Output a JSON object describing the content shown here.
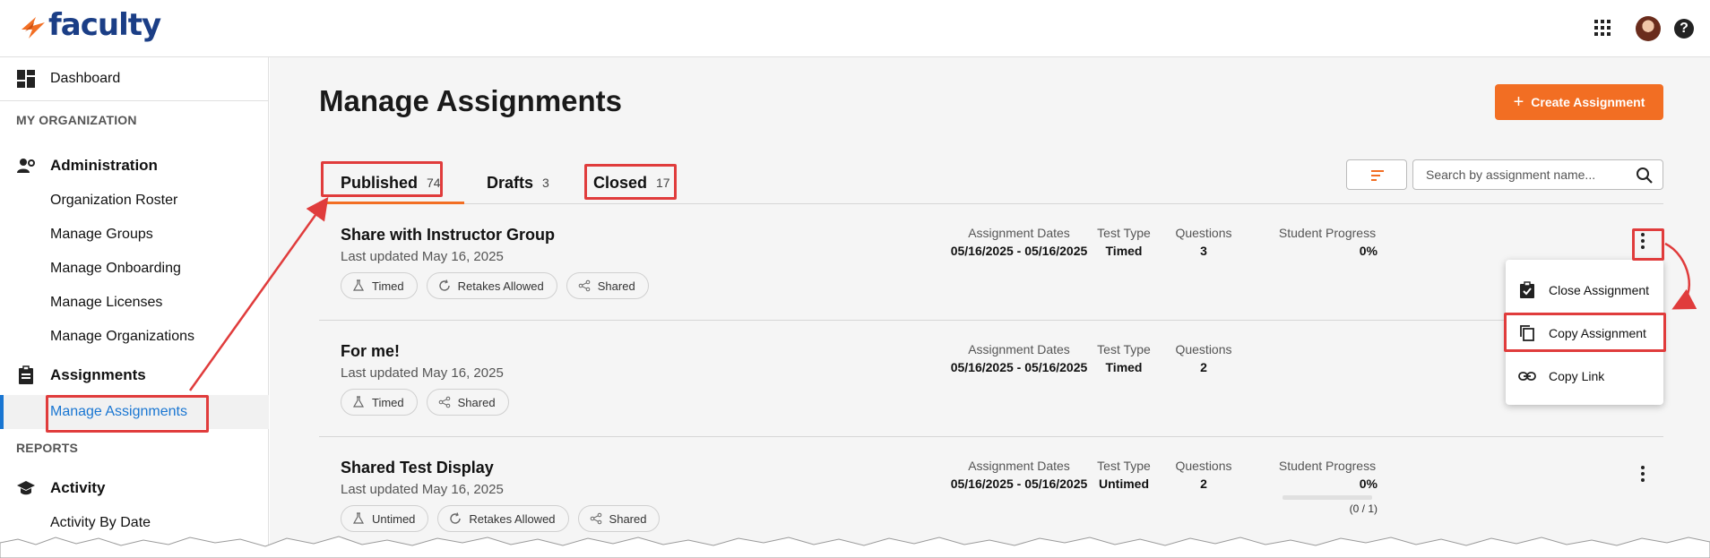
{
  "app": {
    "logo_text": "faculty"
  },
  "sidebar": {
    "dashboard": "Dashboard",
    "section_org": "MY ORGANIZATION",
    "administration": "Administration",
    "admin_items": [
      "Organization Roster",
      "Manage Groups",
      "Manage Onboarding",
      "Manage Licenses",
      "Manage Organizations"
    ],
    "assignments": "Assignments",
    "manage_assignments": "Manage Assignments",
    "section_reports": "REPORTS",
    "activity": "Activity",
    "activity_by_date": "Activity By Date"
  },
  "main": {
    "title": "Manage Assignments",
    "create_label": "Create Assignment",
    "tabs": [
      {
        "label": "Published",
        "count": "74"
      },
      {
        "label": "Drafts",
        "count": "3"
      },
      {
        "label": "Closed",
        "count": "17"
      }
    ],
    "search_placeholder": "Search by assignment name..."
  },
  "meta_labels": {
    "dates": "Assignment Dates",
    "type": "Test Type",
    "questions": "Questions",
    "progress": "Student Progress"
  },
  "assignments": [
    {
      "title": "Share with Instructor Group",
      "updated": "Last updated May 16, 2025",
      "chips": [
        "Timed",
        "Retakes Allowed",
        "Shared"
      ],
      "dates": "05/16/2025 - 05/16/2025",
      "type": "Timed",
      "questions": "3",
      "progress": "0%"
    },
    {
      "title": "For me!",
      "updated": "Last updated May 16, 2025",
      "chips": [
        "Timed",
        "Shared"
      ],
      "dates": "05/16/2025 - 05/16/2025",
      "type": "Timed",
      "questions": "2"
    },
    {
      "title": "Shared Test Display",
      "updated": "Last updated May 16, 2025",
      "chips": [
        "Untimed",
        "Retakes Allowed",
        "Shared"
      ],
      "dates": "05/16/2025 - 05/16/2025",
      "type": "Untimed",
      "questions": "2",
      "progress": "0%",
      "progress_sub": "(0 / 1)"
    }
  ],
  "menu": {
    "close": "Close Assignment",
    "copy": "Copy Assignment",
    "link": "Copy Link"
  },
  "colors": {
    "accent": "#f26e23",
    "brand": "#1b3e86",
    "link": "#1976d2",
    "annotation": "#e03c3c"
  }
}
